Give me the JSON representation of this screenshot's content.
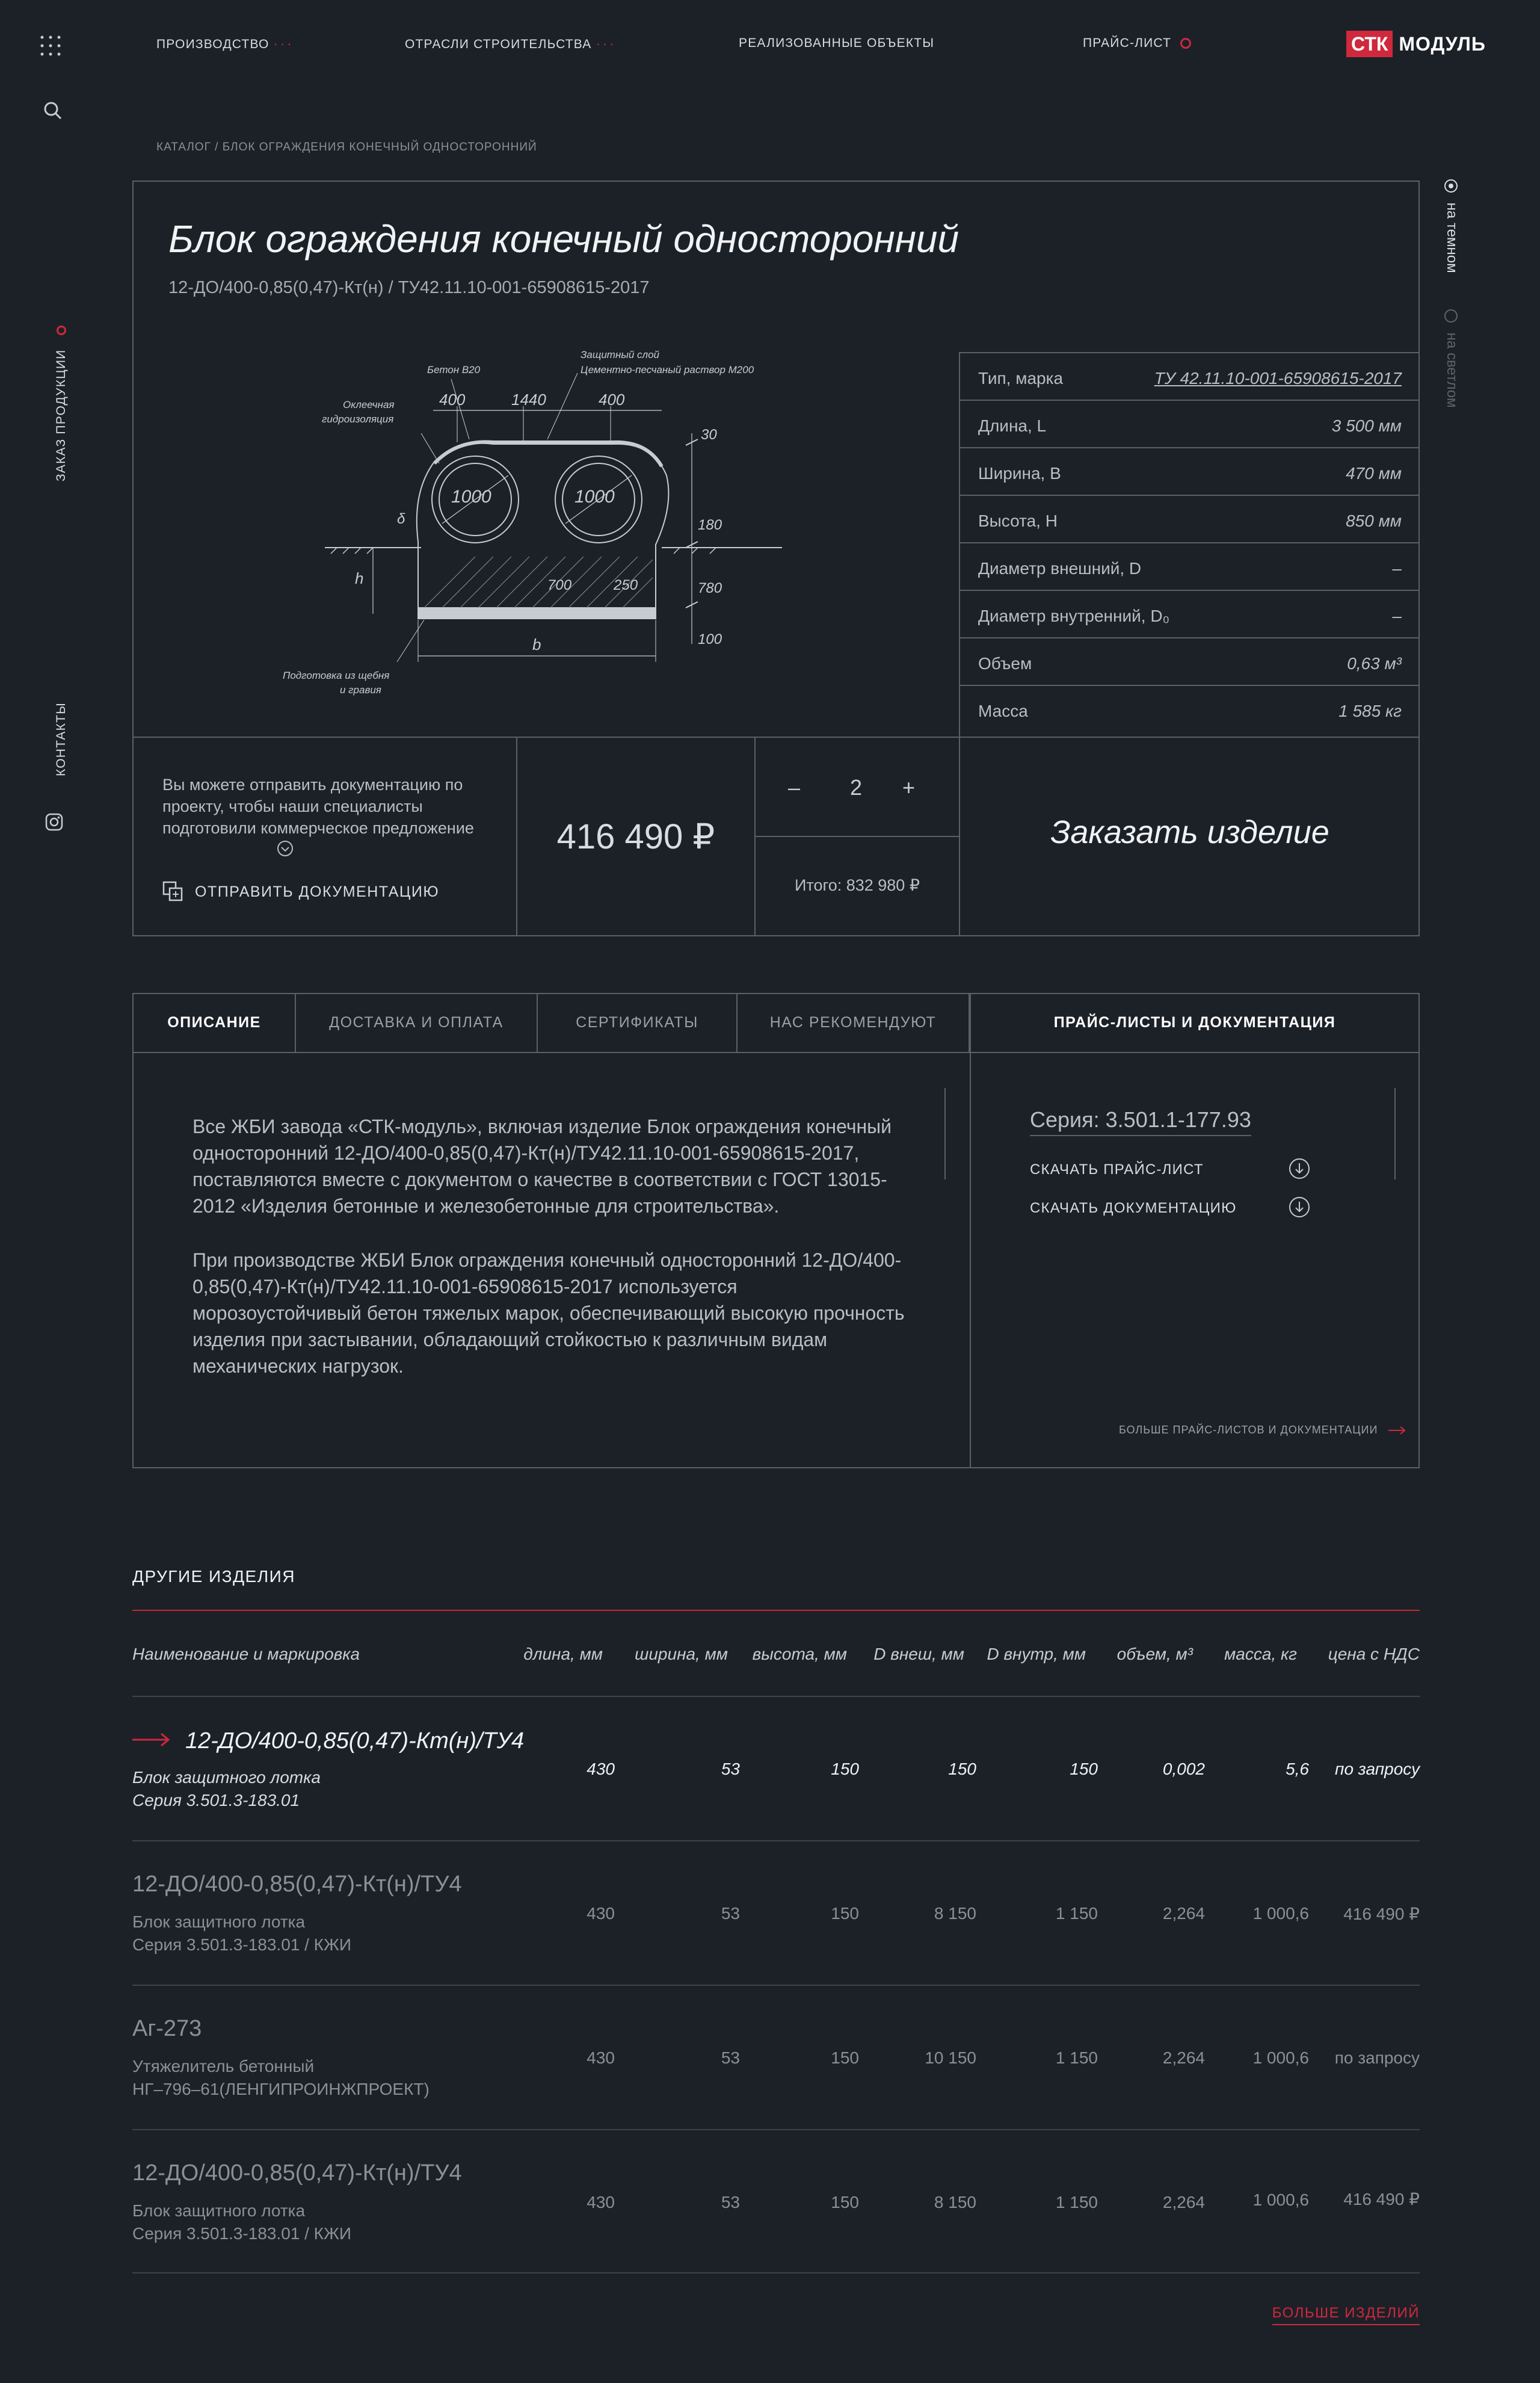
{
  "nav": {
    "items": [
      "ПРОИЗВОДСТВО",
      "ОТРАСЛИ СТРОИТЕЛЬСТВА",
      "РЕАЛИЗОВАННЫЕ ОБЪЕКТЫ",
      "ПРАЙС-ЛИСТ"
    ],
    "logo_badge": "СТК",
    "logo_text": "МОДУЛЬ"
  },
  "sidebar": {
    "order_label": "ЗАКАЗ ПРОДУКЦИИ",
    "contacts_label": "КОНТАКТЫ"
  },
  "theme": {
    "dark": "на темном",
    "light": "на светлом"
  },
  "breadcrumb": "КАТАЛОГ / БЛОК ОГРАЖДЕНИЯ КОНЕЧНЫЙ ОДНОСТОРОННИЙ",
  "product": {
    "title": "Блок ограждения конечный односторонний",
    "subtitle": "12-ДО/400-0,85(0,47)-Кт(н) / ТУ42.11.10-001-65908615-2017",
    "drawing": {
      "beton": "Бетон В20",
      "layer1": "Защитный слой",
      "layer2": "Цементно-песчаный раствор М200",
      "hydro1": "Оклеечная",
      "hydro2": "гидроизоляция",
      "d400a": "400",
      "d1440": "1440",
      "d400b": "400",
      "d30": "30",
      "d1000a": "1000",
      "d1000b": "1000",
      "d180": "180",
      "d780": "780",
      "d100": "100",
      "d250": "250",
      "d700": "700",
      "dh": "h",
      "db": "b",
      "ddelta": "δ",
      "prep1": "Подготовка из щебня",
      "prep2": "и гравия"
    },
    "specs": [
      {
        "k": "Тип, марка",
        "v": "ТУ 42.11.10-001-65908615-2017"
      },
      {
        "k": "Длина, L",
        "v": "3 500 мм"
      },
      {
        "k": "Ширина, B",
        "v": "470 мм"
      },
      {
        "k": "Высота, H",
        "v": "850 мм"
      },
      {
        "k": "Диаметр внешний, D",
        "v": "–"
      },
      {
        "k": "Диаметр внутренний, D₀",
        "v": "–"
      },
      {
        "k": "Объем",
        "v": "0,63 м³"
      },
      {
        "k": "Масса",
        "v": "1 585 кг"
      }
    ],
    "send_text": "Вы можете отправить документацию по проекту, чтобы наши специалисты подготовили коммерческое предложение",
    "send_button": "ОТПРАВИТЬ ДОКУМЕНТАЦИЮ",
    "price": "416 490 ₽",
    "qty_minus": "–",
    "qty": "2",
    "qty_plus": "+",
    "total": "Итого: 832 980 ₽",
    "order_button": "Заказать изделие"
  },
  "tabs": [
    {
      "label": "ОПИСАНИЕ"
    },
    {
      "label": "ДОСТАВКА И ОПЛАТА"
    },
    {
      "label": "СЕРТИФИКАТЫ"
    },
    {
      "label": "НАС РЕКОМЕНДУЮТ"
    },
    {
      "label": "ПРАЙС-ЛИСТЫ И ДОКУМЕНТАЦИЯ"
    }
  ],
  "description": {
    "p1": "Все ЖБИ завода «СТК-модуль», включая изделие Блок ограждения конечный односторонний 12-ДО/400-0,85(0,47)-Кт(н)/ТУ42.11.10-001-65908615-2017, поставляются вместе с документом о качестве в соответствии с ГОСТ 13015-2012 «Изделия бетонные и железобетонные для строительства».",
    "p2": "При производстве ЖБИ Блок ограждения конечный односторонний 12-ДО/400-0,85(0,47)-Кт(н)/ТУ42.11.10-001-65908615-2017 используется морозоустойчивый бетон тяжелых марок, обеспечивающий высокую прочность изделия при застывании, обладающий стойкостью к различным видам механических нагрузок."
  },
  "docs": {
    "series": "Серия: 3.501.1-177.93",
    "download_price": "СКАЧАТЬ ПРАЙС-ЛИСТ",
    "download_docs": "СКАЧАТЬ ДОКУМЕНТАЦИЮ",
    "more": "БОЛЬШЕ ПРАЙС-ЛИСТОВ И ДОКУМЕНТАЦИИ"
  },
  "others": {
    "title": "ДРУГИЕ ИЗДЕЛИЯ",
    "headers": [
      "Наименование и маркировка",
      "длина, мм",
      "ширина, мм",
      "высота, мм",
      "D внеш, мм",
      "D внутр, мм",
      "объем, м³",
      "масса, кг",
      "цена с НДС"
    ],
    "rows": [
      {
        "name": "12-ДО/400-0,85(0,47)-Кт(н)/ТУ4",
        "desc1": "Блок защитного лотка",
        "desc2": "Серия  3.501.3-183.01",
        "vals": [
          "430",
          "53",
          "150",
          "150",
          "150",
          "0,002",
          "5,6",
          "по запросу"
        ]
      },
      {
        "name": "12-ДО/400-0,85(0,47)-Кт(н)/ТУ4",
        "desc1": "Блок защитного лотка",
        "desc2": "Серия  3.501.3-183.01 / КЖИ",
        "vals": [
          "430",
          "53",
          "150",
          "8 150",
          "1 150",
          "2,264",
          "1 000,6",
          "416 490 ₽"
        ]
      },
      {
        "name": "Аг-273",
        "desc1": "Утяжелитель бетонный",
        "desc2": "НГ–796–61(ЛЕНГИПРОИНЖПРОЕКТ)",
        "vals": [
          "430",
          "53",
          "150",
          "10 150",
          "1 150",
          "2,264",
          "1 000,6",
          "по запросу"
        ]
      },
      {
        "name": "12-ДО/400-0,85(0,47)-Кт(н)/ТУ4",
        "desc1": "Блок защитного лотка",
        "desc2": "Серия  3.501.3-183.01 / КЖИ",
        "vals": [
          "430",
          "53",
          "150",
          "8 150",
          "1 150",
          "2,264",
          "1 000,6",
          "416 490 ₽"
        ]
      }
    ],
    "more": "БОЛЬШЕ ИЗДЕЛИЙ"
  }
}
